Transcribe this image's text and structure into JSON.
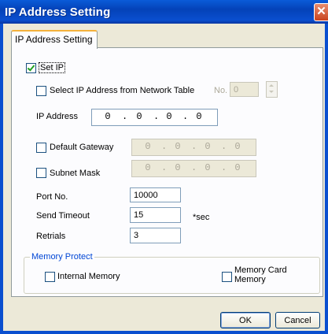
{
  "window": {
    "title": "IP Address Setting",
    "close_glyph": "✕"
  },
  "tab": {
    "label": "IP Address Setting"
  },
  "set_ip": {
    "label": "Set IP",
    "checked": true
  },
  "network_table": {
    "label": "Select IP Address from Network Table",
    "checked": false,
    "no_label": "No.",
    "no_value": "0"
  },
  "ip_address": {
    "label": "IP Address",
    "octets": [
      "0",
      "0",
      "0",
      "0"
    ]
  },
  "default_gateway": {
    "label": "Default Gateway",
    "checked": false,
    "octets": [
      "0",
      "0",
      "0",
      "0"
    ]
  },
  "subnet_mask": {
    "label": "Subnet Mask",
    "checked": false,
    "octets": [
      "0",
      "0",
      "0",
      "0"
    ]
  },
  "port": {
    "label": "Port No.",
    "value": "10000"
  },
  "send_timeout": {
    "label": "Send Timeout",
    "value": "15",
    "unit": "*sec"
  },
  "retrials": {
    "label": "Retrials",
    "value": "3"
  },
  "memory_protect": {
    "label": "Memory Protect",
    "internal": {
      "label": "Internal Memory",
      "checked": false
    },
    "card": {
      "label_line1": "Memory Card",
      "label_line2": "Memory",
      "checked": false
    }
  },
  "buttons": {
    "ok": "OK",
    "cancel": "Cancel"
  }
}
